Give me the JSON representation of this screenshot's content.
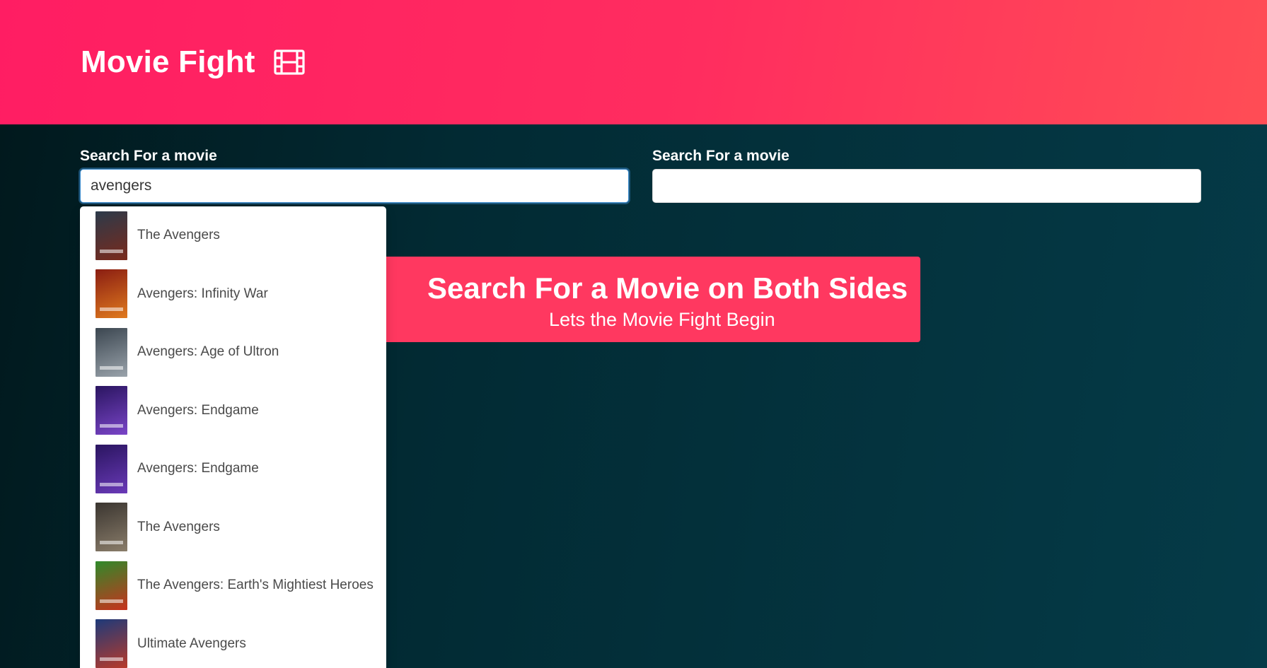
{
  "hero": {
    "title": "Movie Fight",
    "icon": "film-icon",
    "gradient": [
      "#ff1d63",
      "#ff4d55"
    ]
  },
  "left": {
    "label": "Search For a movie",
    "value": "avengers"
  },
  "right": {
    "label": "Search For a movie",
    "value": ""
  },
  "dropdown": {
    "items": [
      {
        "title": "The Avengers",
        "poster": [
          "#2b3a4a",
          "#7a2a1c"
        ]
      },
      {
        "title": "Avengers: Infinity War",
        "poster": [
          "#8a1d12",
          "#e07a1e"
        ]
      },
      {
        "title": "Avengers: Age of Ultron",
        "poster": [
          "#3b4650",
          "#9aa3ab"
        ]
      },
      {
        "title": "Avengers: Endgame",
        "poster": [
          "#2a1560",
          "#7a45c8"
        ]
      },
      {
        "title": "Avengers: Endgame",
        "poster": [
          "#2a1560",
          "#6a3ab8"
        ]
      },
      {
        "title": "The Avengers",
        "poster": [
          "#3a3530",
          "#8a7d6a"
        ]
      },
      {
        "title": "The Avengers: Earth's Mightiest Heroes",
        "poster": [
          "#2f8a2a",
          "#c8321e"
        ]
      },
      {
        "title": "Ultimate Avengers",
        "poster": [
          "#1d3a7a",
          "#b83a2a"
        ]
      }
    ]
  },
  "notice": {
    "title": "Search For a Movie on Both Sides",
    "subtitle": "Lets the Movie Fight Begin",
    "color": "#ff3860"
  }
}
